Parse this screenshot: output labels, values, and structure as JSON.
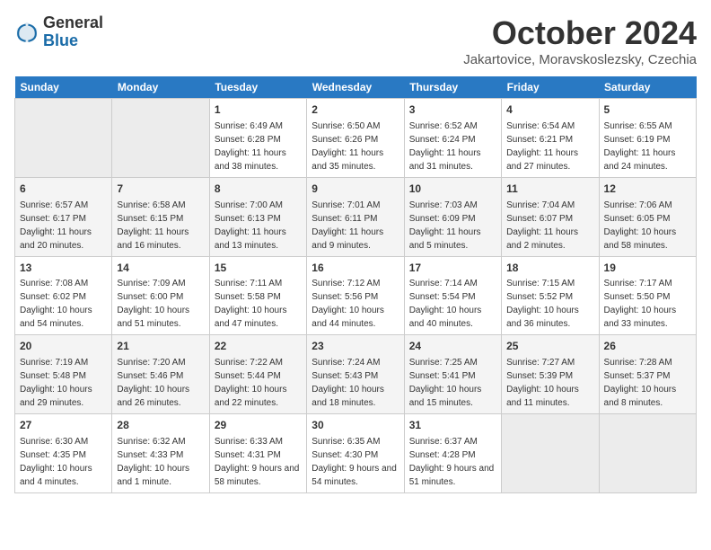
{
  "header": {
    "logo_general": "General",
    "logo_blue": "Blue",
    "month_title": "October 2024",
    "location": "Jakartovice, Moravskoslezsky, Czechia"
  },
  "columns": [
    "Sunday",
    "Monday",
    "Tuesday",
    "Wednesday",
    "Thursday",
    "Friday",
    "Saturday"
  ],
  "rows": [
    [
      {
        "num": "",
        "info": ""
      },
      {
        "num": "",
        "info": ""
      },
      {
        "num": "1",
        "info": "Sunrise: 6:49 AM\nSunset: 6:28 PM\nDaylight: 11 hours and 38 minutes."
      },
      {
        "num": "2",
        "info": "Sunrise: 6:50 AM\nSunset: 6:26 PM\nDaylight: 11 hours and 35 minutes."
      },
      {
        "num": "3",
        "info": "Sunrise: 6:52 AM\nSunset: 6:24 PM\nDaylight: 11 hours and 31 minutes."
      },
      {
        "num": "4",
        "info": "Sunrise: 6:54 AM\nSunset: 6:21 PM\nDaylight: 11 hours and 27 minutes."
      },
      {
        "num": "5",
        "info": "Sunrise: 6:55 AM\nSunset: 6:19 PM\nDaylight: 11 hours and 24 minutes."
      }
    ],
    [
      {
        "num": "6",
        "info": "Sunrise: 6:57 AM\nSunset: 6:17 PM\nDaylight: 11 hours and 20 minutes."
      },
      {
        "num": "7",
        "info": "Sunrise: 6:58 AM\nSunset: 6:15 PM\nDaylight: 11 hours and 16 minutes."
      },
      {
        "num": "8",
        "info": "Sunrise: 7:00 AM\nSunset: 6:13 PM\nDaylight: 11 hours and 13 minutes."
      },
      {
        "num": "9",
        "info": "Sunrise: 7:01 AM\nSunset: 6:11 PM\nDaylight: 11 hours and 9 minutes."
      },
      {
        "num": "10",
        "info": "Sunrise: 7:03 AM\nSunset: 6:09 PM\nDaylight: 11 hours and 5 minutes."
      },
      {
        "num": "11",
        "info": "Sunrise: 7:04 AM\nSunset: 6:07 PM\nDaylight: 11 hours and 2 minutes."
      },
      {
        "num": "12",
        "info": "Sunrise: 7:06 AM\nSunset: 6:05 PM\nDaylight: 10 hours and 58 minutes."
      }
    ],
    [
      {
        "num": "13",
        "info": "Sunrise: 7:08 AM\nSunset: 6:02 PM\nDaylight: 10 hours and 54 minutes."
      },
      {
        "num": "14",
        "info": "Sunrise: 7:09 AM\nSunset: 6:00 PM\nDaylight: 10 hours and 51 minutes."
      },
      {
        "num": "15",
        "info": "Sunrise: 7:11 AM\nSunset: 5:58 PM\nDaylight: 10 hours and 47 minutes."
      },
      {
        "num": "16",
        "info": "Sunrise: 7:12 AM\nSunset: 5:56 PM\nDaylight: 10 hours and 44 minutes."
      },
      {
        "num": "17",
        "info": "Sunrise: 7:14 AM\nSunset: 5:54 PM\nDaylight: 10 hours and 40 minutes."
      },
      {
        "num": "18",
        "info": "Sunrise: 7:15 AM\nSunset: 5:52 PM\nDaylight: 10 hours and 36 minutes."
      },
      {
        "num": "19",
        "info": "Sunrise: 7:17 AM\nSunset: 5:50 PM\nDaylight: 10 hours and 33 minutes."
      }
    ],
    [
      {
        "num": "20",
        "info": "Sunrise: 7:19 AM\nSunset: 5:48 PM\nDaylight: 10 hours and 29 minutes."
      },
      {
        "num": "21",
        "info": "Sunrise: 7:20 AM\nSunset: 5:46 PM\nDaylight: 10 hours and 26 minutes."
      },
      {
        "num": "22",
        "info": "Sunrise: 7:22 AM\nSunset: 5:44 PM\nDaylight: 10 hours and 22 minutes."
      },
      {
        "num": "23",
        "info": "Sunrise: 7:24 AM\nSunset: 5:43 PM\nDaylight: 10 hours and 18 minutes."
      },
      {
        "num": "24",
        "info": "Sunrise: 7:25 AM\nSunset: 5:41 PM\nDaylight: 10 hours and 15 minutes."
      },
      {
        "num": "25",
        "info": "Sunrise: 7:27 AM\nSunset: 5:39 PM\nDaylight: 10 hours and 11 minutes."
      },
      {
        "num": "26",
        "info": "Sunrise: 7:28 AM\nSunset: 5:37 PM\nDaylight: 10 hours and 8 minutes."
      }
    ],
    [
      {
        "num": "27",
        "info": "Sunrise: 6:30 AM\nSunset: 4:35 PM\nDaylight: 10 hours and 4 minutes."
      },
      {
        "num": "28",
        "info": "Sunrise: 6:32 AM\nSunset: 4:33 PM\nDaylight: 10 hours and 1 minute."
      },
      {
        "num": "29",
        "info": "Sunrise: 6:33 AM\nSunset: 4:31 PM\nDaylight: 9 hours and 58 minutes."
      },
      {
        "num": "30",
        "info": "Sunrise: 6:35 AM\nSunset: 4:30 PM\nDaylight: 9 hours and 54 minutes."
      },
      {
        "num": "31",
        "info": "Sunrise: 6:37 AM\nSunset: 4:28 PM\nDaylight: 9 hours and 51 minutes."
      },
      {
        "num": "",
        "info": ""
      },
      {
        "num": "",
        "info": ""
      }
    ]
  ]
}
